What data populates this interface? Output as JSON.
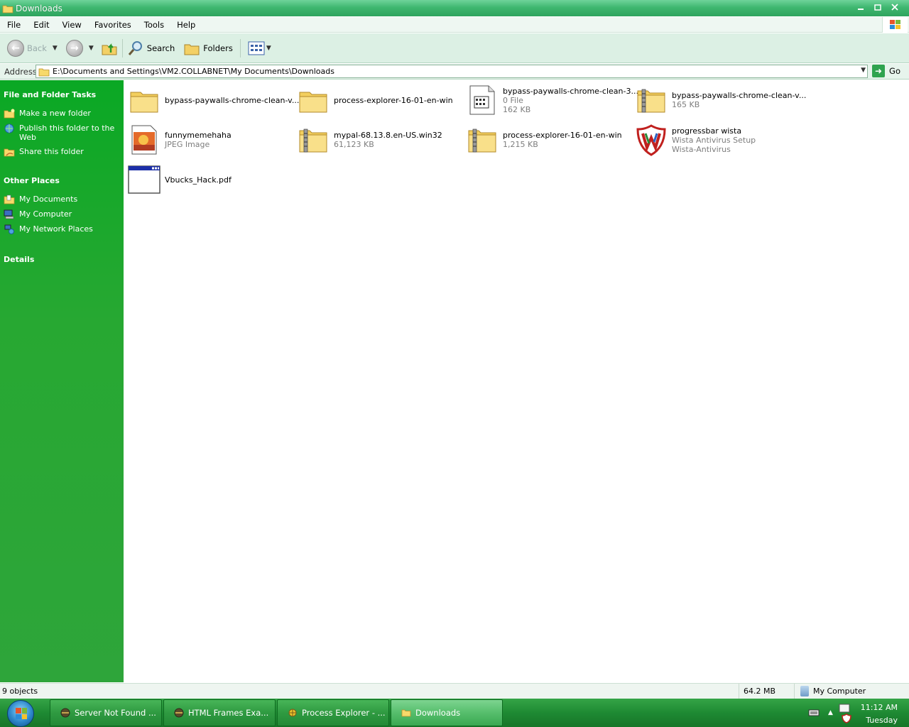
{
  "window": {
    "title": "Downloads",
    "buttons": [
      "minimize",
      "maximize",
      "close"
    ]
  },
  "menubar": {
    "items": [
      "File",
      "Edit",
      "View",
      "Favorites",
      "Tools",
      "Help"
    ]
  },
  "toolbar": {
    "back_label": "Back",
    "search_label": "Search",
    "folders_label": "Folders"
  },
  "addressbar": {
    "label": "Address",
    "path": "E:\\Documents and Settings\\VM2.COLLABNET\\My Documents\\Downloads",
    "go_label": "Go"
  },
  "taskpane": {
    "file_folder_tasks": {
      "title": "File and Folder Tasks",
      "items": [
        {
          "label": "Make a new folder",
          "icon": "new-folder-icon"
        },
        {
          "label": "Publish this folder to the Web",
          "icon": "publish-web-icon"
        },
        {
          "label": "Share this folder",
          "icon": "share-folder-icon"
        }
      ]
    },
    "other_places": {
      "title": "Other Places",
      "items": [
        {
          "label": "My Documents",
          "icon": "my-documents-icon"
        },
        {
          "label": "My Computer",
          "icon": "my-computer-icon"
        },
        {
          "label": "My Network Places",
          "icon": "network-places-icon"
        }
      ]
    },
    "details": {
      "title": "Details"
    }
  },
  "files": [
    {
      "name": "bypass-paywalls-chrome-clean-v...",
      "line2": "",
      "line3": "",
      "icon": "folder-icon"
    },
    {
      "name": "process-explorer-16-01-en-win",
      "line2": "",
      "line3": "",
      "icon": "folder-icon"
    },
    {
      "name": "bypass-paywalls-chrome-clean-3....",
      "line2": "0 File",
      "line3": "162 KB",
      "icon": "file-icon"
    },
    {
      "name": "bypass-paywalls-chrome-clean-v...",
      "line2": "165 KB",
      "line3": "",
      "icon": "zip-folder-icon"
    },
    {
      "name": "funnymemehaha",
      "line2": "JPEG Image",
      "line3": "",
      "icon": "jpeg-image-icon"
    },
    {
      "name": "mypal-68.13.8.en-US.win32",
      "line2": "61,123 KB",
      "line3": "",
      "icon": "zip-folder-icon"
    },
    {
      "name": "process-explorer-16-01-en-win",
      "line2": "1,215 KB",
      "line3": "",
      "icon": "zip-folder-icon"
    },
    {
      "name": "progressbar wista",
      "line2": "Wista Antivirus Setup",
      "line3": "Wista-Antivirus",
      "icon": "antivirus-shield-icon"
    },
    {
      "name": "Vbucks_Hack.pdf",
      "line2": "",
      "line3": "",
      "icon": "window-app-icon"
    }
  ],
  "statusbar": {
    "objects": "9 objects",
    "size": "64.2 MB",
    "zone": "My Computer"
  },
  "taskbar": {
    "buttons": [
      {
        "label": "Server Not Found ...",
        "icon": "browser-icon"
      },
      {
        "label": "HTML Frames Exa...",
        "icon": "browser-icon"
      },
      {
        "label": "Process Explorer - ...",
        "icon": "process-explorer-icon"
      },
      {
        "label": "Downloads",
        "icon": "folder-icon"
      }
    ],
    "clock_time": "11:12 AM",
    "clock_day": "Tuesday"
  },
  "colors": {
    "taskpane_green": "#0aa824",
    "titlebar_green": "#3fb770",
    "taskbar_green": "#1e8a33"
  }
}
